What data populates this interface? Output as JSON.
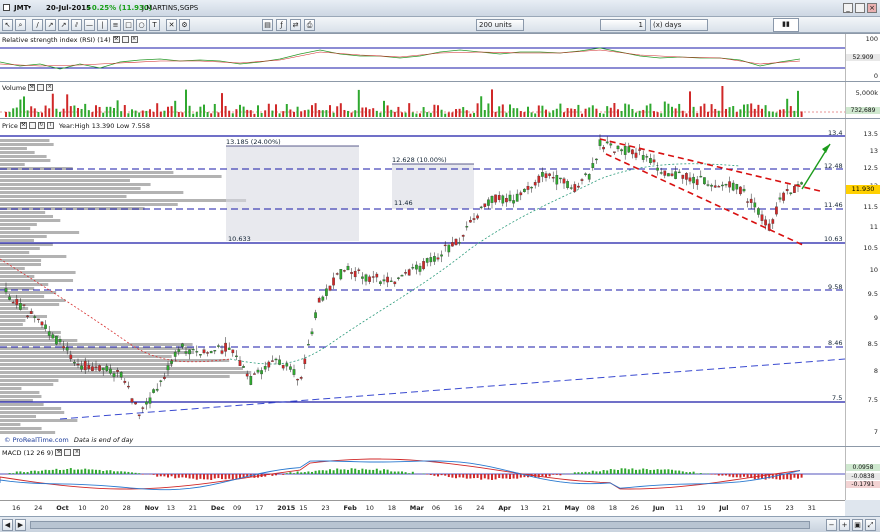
{
  "window": {
    "symbol": "JMT",
    "date": "20-Jul-2015",
    "change": "+0.25% (11.930)",
    "company": "J.MARTINS,SGPS",
    "units": "200 units",
    "period_value": "1",
    "period_unit": "(x) days"
  },
  "rsi": {
    "title": "Relative strength index (RSI) (14)",
    "value": "52.909",
    "ticks": [
      "100",
      "0"
    ]
  },
  "volume": {
    "title": "Volume",
    "value": "732,689",
    "ticks": [
      "5,000k"
    ]
  },
  "price": {
    "title": "Price",
    "year_stats": "Year:High 13.390 Low 7.558",
    "current": "11.930",
    "ticks": [
      "13.5",
      "13",
      "12.5",
      "12",
      "11.5",
      "11",
      "10.5",
      "10",
      "9.5",
      "9",
      "8.5",
      "8",
      "7.5",
      "7"
    ],
    "levels": [
      "13.4",
      "12.48",
      "11.46",
      "10.63",
      "9.58",
      "8.46",
      "7.5"
    ],
    "fib_labels": [
      "13.185 (24.00%)",
      "12.628 (10.00%)",
      "11.46",
      "10.633"
    ],
    "footer_brand": "© ProRealTime.com",
    "footer_note": "Data is end of day"
  },
  "macd": {
    "title": "MACD (12 26 9)",
    "values": [
      "0.0958",
      "-0.0838",
      "-0.1791"
    ]
  },
  "time_axis": {
    "numbers": [
      "16",
      "24",
      "Oct",
      "10",
      "20",
      "28",
      "Nov",
      "13",
      "21",
      "Dec",
      "09",
      "17",
      "2015",
      "15",
      "23",
      "Feb",
      "10",
      "18",
      "Mar",
      "06",
      "16",
      "24",
      "Apr",
      "13",
      "21",
      "May",
      "08",
      "18",
      "26",
      "Jun",
      "11",
      "19",
      "Jul",
      "07",
      "15",
      "23",
      "31"
    ]
  },
  "colors": {
    "up": "#2fa82f",
    "down": "#d02828",
    "level": "#1a1aa8",
    "trend": "#d81010",
    "arrow": "#1c9b1c",
    "ma": "#2a9a7a",
    "highlight": "#ffd000"
  }
}
